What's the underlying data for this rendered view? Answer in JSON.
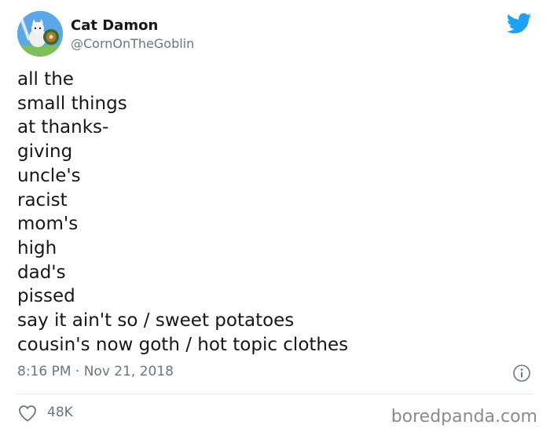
{
  "author": {
    "display_name": "Cat Damon",
    "handle": "@CornOnTheGoblin"
  },
  "tweet": {
    "lines": [
      "all the",
      "small things",
      "at thanks-",
      "giving",
      "uncle's",
      "racist",
      "mom's",
      "high",
      "dad's",
      "pissed",
      "say it ain't so / sweet potatoes",
      "cousin's now goth / hot topic clothes"
    ],
    "timestamp": "8:16 PM · Nov 21, 2018",
    "like_count": "48K"
  },
  "watermark": "boredpanda.com",
  "icons": {
    "brand": "twitter-bird-icon",
    "info": "info-icon",
    "like": "heart-icon"
  },
  "colors": {
    "twitter_blue": "#1da1f2",
    "secondary_text": "#657786",
    "primary_text": "#14171a",
    "divider": "#e1e8ed"
  }
}
